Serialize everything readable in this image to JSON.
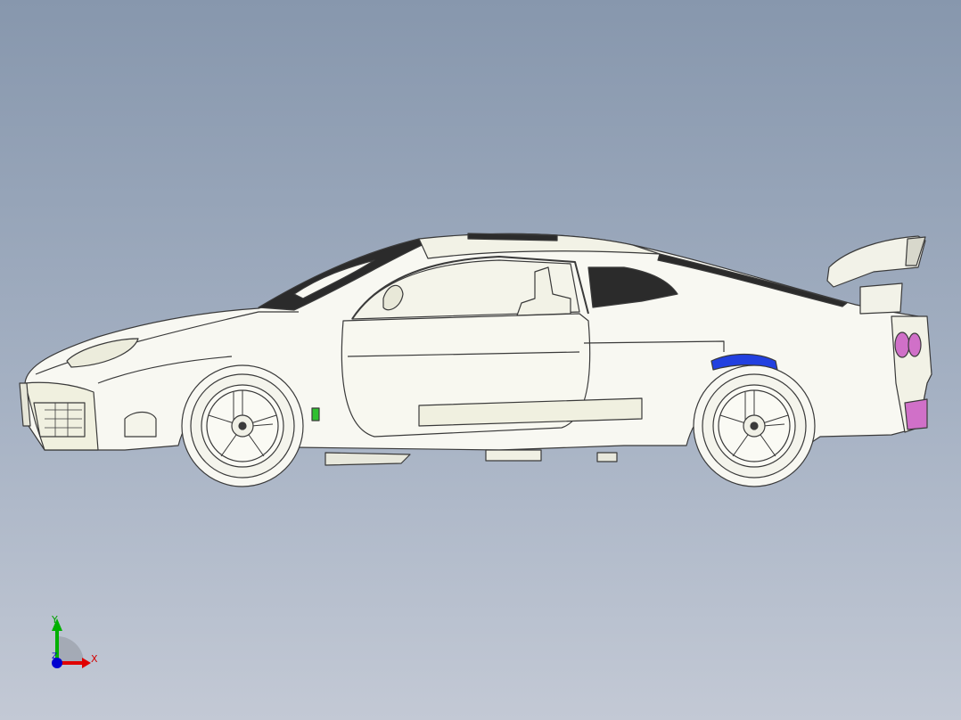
{
  "viewport": {
    "background_top": "#8797ad",
    "background_bottom": "#c3c9d5"
  },
  "model": {
    "body_color": "#f8f8f2",
    "outline_color": "#3a3a3a",
    "glass_color": "#2b2b2b",
    "fender_liner_color": "#2240e0",
    "tail_light_color": "#d070c8"
  },
  "triad": {
    "x_label": "X",
    "y_label": "Y",
    "z_label": "Z",
    "x_color": "#e00000",
    "y_color": "#00b000",
    "z_color": "#0000d0"
  }
}
